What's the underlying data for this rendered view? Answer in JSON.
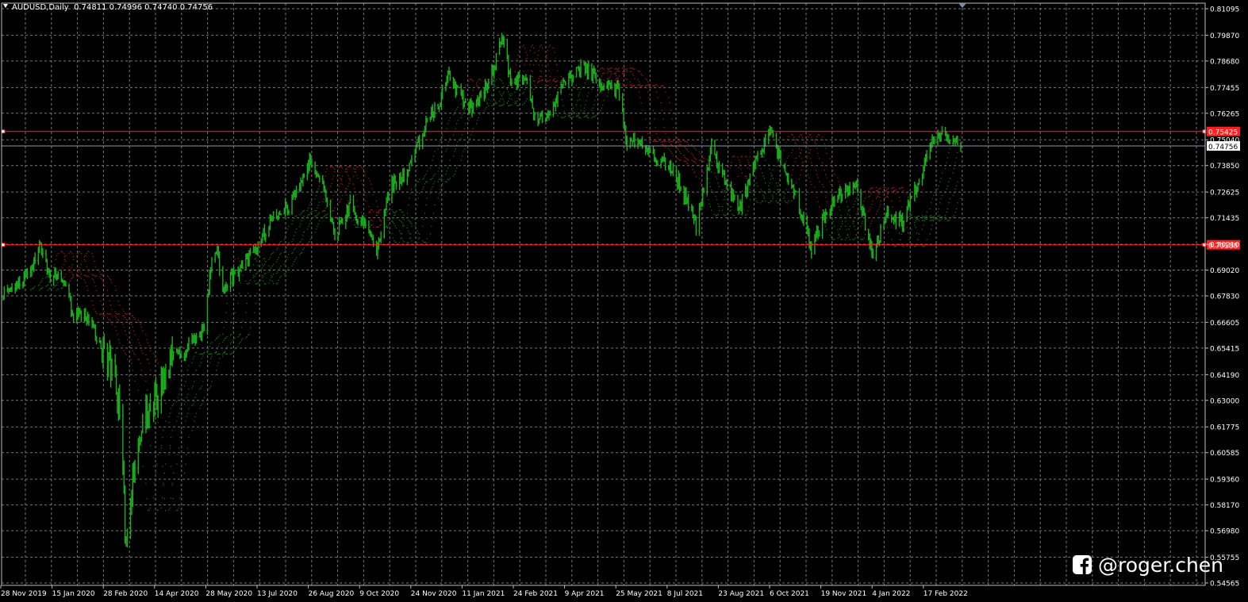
{
  "header": {
    "symbol": "AUDUSD,Daily",
    "open": "0.74811",
    "high": "0.74996",
    "low": "0.74740",
    "close": "0.74756"
  },
  "watermark": {
    "icon": "facebook-icon",
    "text": "@roger.chen"
  },
  "colors": {
    "background": "#000000",
    "grid": "#777777",
    "frame": "#bbbbbb",
    "axis_text": "#ffffff",
    "candle": "#19b01a",
    "ribbon_up": "#1a7a1a",
    "ribbon_down": "#a52222",
    "level_line": "#ff2020",
    "bid_line": "#8a97a6"
  },
  "chart_data": {
    "type": "candlestick",
    "instrument": "AUDUSD",
    "timeframe": "Daily",
    "x_axis": {
      "labels": [
        "28 Nov 2019",
        "15 Jan 2020",
        "28 Feb 2020",
        "14 Apr 2020",
        "28 May 2020",
        "13 Jul 2020",
        "26 Aug 2020",
        "9 Oct 2020",
        "24 Nov 2020",
        "11 Jan 2021",
        "24 Feb 2021",
        "9 Apr 2021",
        "25 May 2021",
        "8 Jul 2021",
        "23 Aug 2021",
        "6 Oct 2021",
        "19 Nov 2021",
        "4 Jan 2022",
        "17 Feb 2022"
      ],
      "range": [
        "2019-11-28",
        "2022-04-18"
      ]
    },
    "y_axis": {
      "labels": [
        "0.81095",
        "0.79870",
        "0.78680",
        "0.77455",
        "0.76265",
        "0.75040",
        "0.73850",
        "0.72625",
        "0.71435",
        "0.70210",
        "0.69020",
        "0.67830",
        "0.66605",
        "0.65415",
        "0.64190",
        "0.63000",
        "0.61775",
        "0.60585",
        "0.59360",
        "0.58170",
        "0.56980",
        "0.55755",
        "0.54565"
      ],
      "range": [
        0.54565,
        0.81095
      ],
      "position": "right"
    },
    "grid": true,
    "price_path": [
      [
        "2019-11-28",
        0.678
      ],
      [
        "2019-12-10",
        0.684
      ],
      [
        "2019-12-20",
        0.688
      ],
      [
        "2019-12-31",
        0.701
      ],
      [
        "2020-01-10",
        0.688
      ],
      [
        "2020-01-20",
        0.688
      ],
      [
        "2020-01-31",
        0.67
      ],
      [
        "2020-02-10",
        0.669
      ],
      [
        "2020-02-21",
        0.66
      ],
      [
        "2020-02-28",
        0.654
      ],
      [
        "2020-03-09",
        0.64
      ],
      [
        "2020-03-13",
        0.62
      ],
      [
        "2020-03-19",
        0.56
      ],
      [
        "2020-03-23",
        0.585
      ],
      [
        "2020-03-31",
        0.613
      ],
      [
        "2020-04-08",
        0.625
      ],
      [
        "2020-04-20",
        0.635
      ],
      [
        "2020-04-30",
        0.651
      ],
      [
        "2020-05-08",
        0.652
      ],
      [
        "2020-05-19",
        0.657
      ],
      [
        "2020-05-29",
        0.664
      ],
      [
        "2020-06-05",
        0.695
      ],
      [
        "2020-06-10",
        0.699
      ],
      [
        "2020-06-15",
        0.682
      ],
      [
        "2020-06-30",
        0.69
      ],
      [
        "2020-07-15",
        0.7
      ],
      [
        "2020-07-31",
        0.715
      ],
      [
        "2020-08-15",
        0.72
      ],
      [
        "2020-08-31",
        0.737
      ],
      [
        "2020-09-02",
        0.74
      ],
      [
        "2020-09-15",
        0.729
      ],
      [
        "2020-09-25",
        0.706
      ],
      [
        "2020-10-09",
        0.72
      ],
      [
        "2020-10-20",
        0.712
      ],
      [
        "2020-11-02",
        0.7
      ],
      [
        "2020-11-16",
        0.73
      ],
      [
        "2020-11-30",
        0.735
      ],
      [
        "2020-12-15",
        0.755
      ],
      [
        "2020-12-31",
        0.77
      ],
      [
        "2021-01-06",
        0.78
      ],
      [
        "2021-01-15",
        0.772
      ],
      [
        "2021-01-29",
        0.764
      ],
      [
        "2021-02-12",
        0.776
      ],
      [
        "2021-02-25",
        0.798
      ],
      [
        "2021-03-05",
        0.775
      ],
      [
        "2021-03-18",
        0.78
      ],
      [
        "2021-03-26",
        0.76
      ],
      [
        "2021-04-09",
        0.761
      ],
      [
        "2021-04-21",
        0.776
      ],
      [
        "2021-05-10",
        0.785
      ],
      [
        "2021-05-25",
        0.776
      ],
      [
        "2021-06-10",
        0.774
      ],
      [
        "2021-06-18",
        0.749
      ],
      [
        "2021-07-01",
        0.75
      ],
      [
        "2021-07-15",
        0.742
      ],
      [
        "2021-07-31",
        0.736
      ],
      [
        "2021-08-20",
        0.711
      ],
      [
        "2021-09-03",
        0.747
      ],
      [
        "2021-09-15",
        0.731
      ],
      [
        "2021-09-29",
        0.719
      ],
      [
        "2021-10-15",
        0.743
      ],
      [
        "2021-10-27",
        0.754
      ],
      [
        "2021-11-05",
        0.74
      ],
      [
        "2021-11-19",
        0.724
      ],
      [
        "2021-12-03",
        0.7
      ],
      [
        "2021-12-15",
        0.715
      ],
      [
        "2021-12-31",
        0.727
      ],
      [
        "2022-01-13",
        0.728
      ],
      [
        "2022-01-28",
        0.697
      ],
      [
        "2022-02-10",
        0.717
      ],
      [
        "2022-02-24",
        0.712
      ],
      [
        "2022-03-10",
        0.731
      ],
      [
        "2022-03-22",
        0.748
      ],
      [
        "2022-04-04",
        0.753
      ],
      [
        "2022-04-18",
        0.7476
      ]
    ],
    "ribbon_lag_days": [
      16,
      24,
      32,
      40
    ],
    "levels": [
      {
        "kind": "level",
        "value": 0.75425,
        "label": "0.75425"
      },
      {
        "kind": "level",
        "value": 0.70188,
        "label": "0.70188"
      },
      {
        "kind": "bid",
        "value": 0.74756,
        "label": "0.74756"
      }
    ],
    "last_bar_date": "2022-04-18"
  }
}
